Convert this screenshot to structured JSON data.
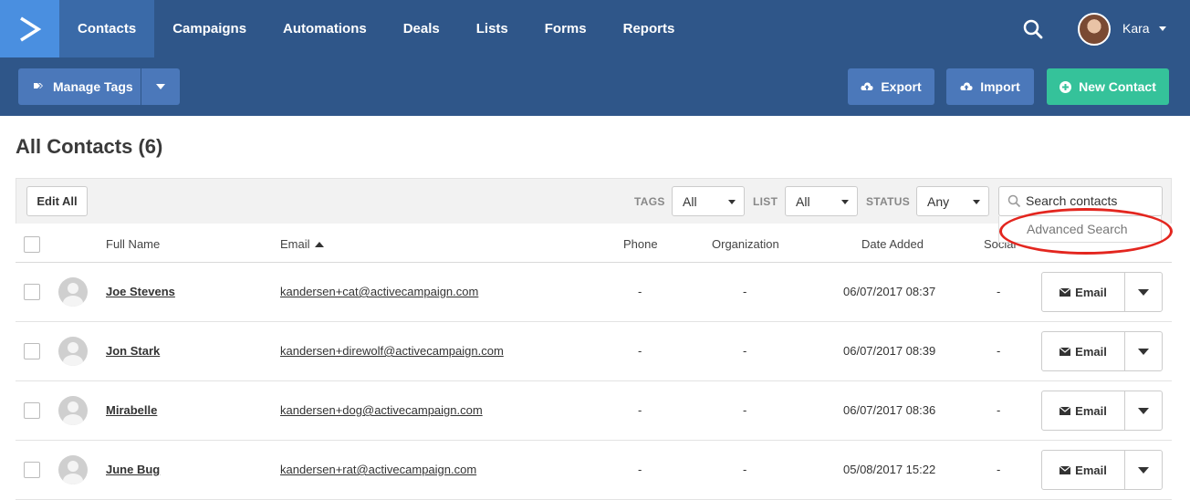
{
  "nav": {
    "items": [
      {
        "label": "Contacts",
        "active": true
      },
      {
        "label": "Campaigns",
        "active": false
      },
      {
        "label": "Automations",
        "active": false
      },
      {
        "label": "Deals",
        "active": false
      },
      {
        "label": "Lists",
        "active": false
      },
      {
        "label": "Forms",
        "active": false
      },
      {
        "label": "Reports",
        "active": false
      }
    ],
    "user_name": "Kara",
    "icons": {
      "logo": "activecampaign-chevron-logo",
      "search": "search-icon",
      "avatar": "user-avatar-photo"
    }
  },
  "toolbar": {
    "manage_tags_label": "Manage Tags",
    "export_label": "Export",
    "import_label": "Import",
    "new_contact_label": "New Contact",
    "colors": {
      "band": "#2f5689",
      "button": "#4b78ba",
      "new_contact": "#35c29a"
    }
  },
  "page": {
    "title": "All Contacts (6)"
  },
  "filters": {
    "edit_all_label": "Edit All",
    "tags_label": "TAGS",
    "tags_value": "All",
    "list_label": "LIST",
    "list_value": "All",
    "status_label": "STATUS",
    "status_value": "Any",
    "search_placeholder": "Search contacts",
    "advanced_search_label": "Advanced Search",
    "highlight_color": "#e3261f"
  },
  "table": {
    "columns": {
      "full_name": "Full Name",
      "email": "Email",
      "phone": "Phone",
      "organization": "Organization",
      "date_added": "Date Added",
      "social": "Social"
    },
    "email_button_label": "Email",
    "rows": [
      {
        "name": "Joe Stevens",
        "email": "kandersen+cat@activecampaign.com",
        "phone": "-",
        "organization": "-",
        "date_added": "06/07/2017 08:37",
        "social": "-"
      },
      {
        "name": "Jon Stark",
        "email": "kandersen+direwolf@activecampaign.com",
        "phone": "-",
        "organization": "-",
        "date_added": "06/07/2017 08:39",
        "social": "-"
      },
      {
        "name": "Mirabelle",
        "email": "kandersen+dog@activecampaign.com",
        "phone": "-",
        "organization": "-",
        "date_added": "06/07/2017 08:36",
        "social": "-"
      },
      {
        "name": "June Bug",
        "email": "kandersen+rat@activecampaign.com",
        "phone": "-",
        "organization": "-",
        "date_added": "05/08/2017 15:22",
        "social": "-"
      }
    ]
  }
}
